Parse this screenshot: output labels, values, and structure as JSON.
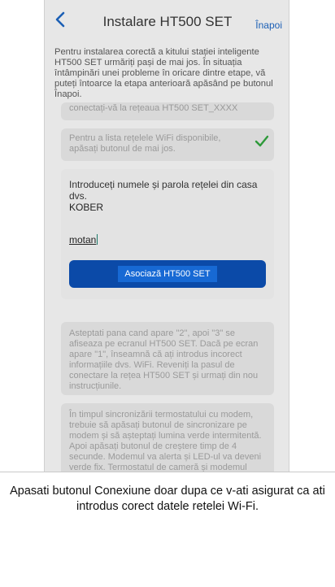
{
  "header": {
    "back_icon": "chevron-left-icon",
    "title": "Instalare HT500 SET",
    "back_label": "Înapoi"
  },
  "intro_text": "Pentru instalarea corectă a kitului stației inteligente HT500 SET urmăriți pași de mai jos. În situația întâmpinări unei probleme în oricare dintre etape, vă puteți întoarce la etapa anterioară apăsând pe butonul Înapoi.",
  "steps": {
    "connect_text": "conectați-vă la rețeaua HT500 SET_XXXX",
    "wifi_list_text": "Pentru a lista rețelele WiFi disponibile, apăsați butonul de mai jos.",
    "check_icon": "checkmark-icon"
  },
  "form": {
    "label": "Introduceți numele și parola rețelei din casa dvs.",
    "ssid_value": "KOBER",
    "password_value": "motan",
    "associate_button": "Asociază HT500 SET"
  },
  "wait_text": "Asteptati pana cand apare \"2\", apoi \"3\" se afiseaza pe ecranul HT500 SET. Dacă pe ecran apare \"1\", înseamnă că ați introdus incorect informațiile dvs. WiFi. Reveniți la pasul de conectare la rețea HT500 SET și urmați din nou instrucțiunile.",
  "sync_text": "În timpul sincronizării termostatului cu modem, trebuie să apăsați butonul de sincronizare pe modem și să așteptați lumina verde intermitentă. Apoi apăsați butonul de creștere timp de 4 secunde. Modemul va alerta și LED-ul va deveni verde fix. Termostatul de cameră și modemul sunt sincronizate acum. Veți vedea",
  "caption": "Apasati butonul Conexiune doar dupa ce v-ati asigurat ca ati introdus corect datele retelei Wi-Fi.",
  "colors": {
    "accent": "#1b5fb5",
    "button": "#0b4aa8",
    "check": "#2e9a3a"
  }
}
